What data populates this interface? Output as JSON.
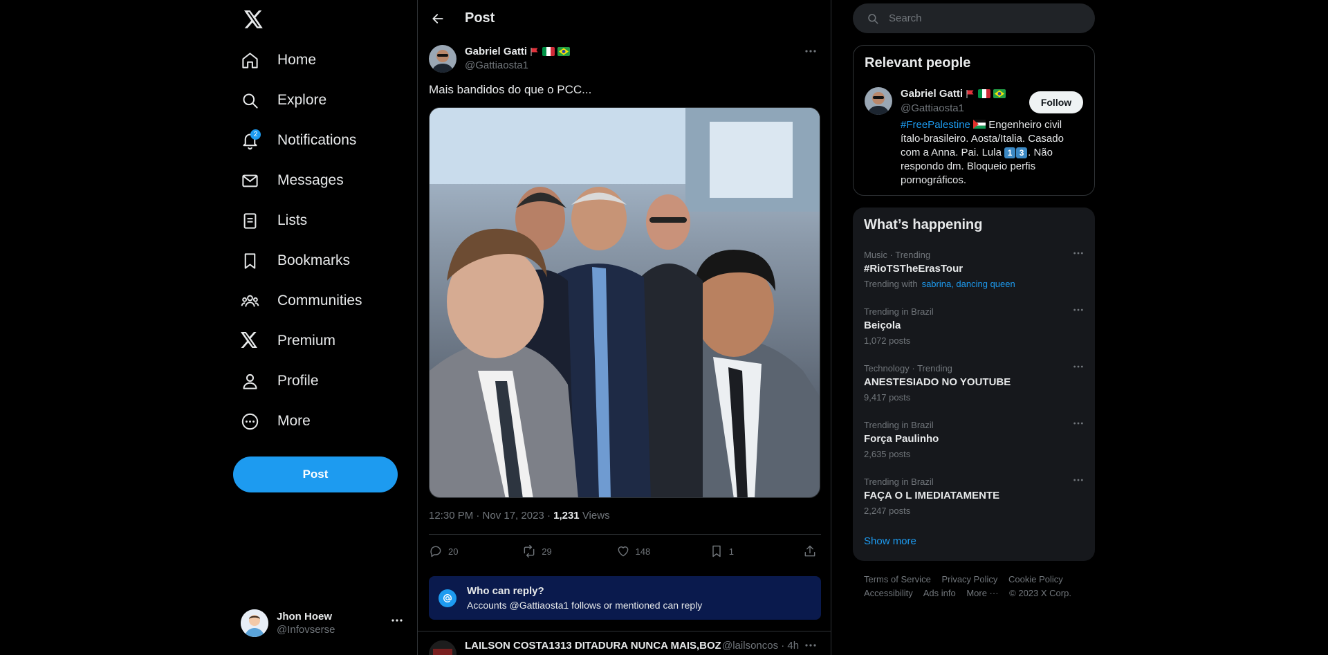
{
  "nav": {
    "logo": "x-logo",
    "items": [
      {
        "label": "Home",
        "icon": "home-icon"
      },
      {
        "label": "Explore",
        "icon": "search-icon"
      },
      {
        "label": "Notifications",
        "icon": "bell-icon",
        "badge": "2"
      },
      {
        "label": "Messages",
        "icon": "envelope-icon"
      },
      {
        "label": "Lists",
        "icon": "list-icon"
      },
      {
        "label": "Bookmarks",
        "icon": "bookmark-icon"
      },
      {
        "label": "Communities",
        "icon": "people-icon"
      },
      {
        "label": "Premium",
        "icon": "x-icon"
      },
      {
        "label": "Profile",
        "icon": "person-icon"
      },
      {
        "label": "More",
        "icon": "more-circle-icon"
      }
    ],
    "post_button": "Post",
    "account": {
      "name": "Jhon Hoew",
      "handle": "@Infovserse"
    }
  },
  "header": {
    "title": "Post"
  },
  "post": {
    "author_name": "Gabriel Gatti",
    "author_handle": "@Gattiaosta1",
    "text": "Mais bandidos do que o PCC...",
    "time": "12:30 PM · Nov 17, 2023",
    "views_count": "1,231",
    "views_label": "Views",
    "replies": "20",
    "reposts": "29",
    "likes": "148",
    "bookmarks": "1"
  },
  "reply_restriction": {
    "title": "Who can reply?",
    "text": "Accounts @Gattiaosta1 follows or mentioned can reply"
  },
  "next_post": {
    "name": "LAILSON COSTA1313 DITADURA NUNCA MAIS,BOZO",
    "handle": "@lailsoncos · 4h"
  },
  "search": {
    "placeholder": "Search"
  },
  "relevant_people": {
    "title": "Relevant people",
    "name": "Gabriel Gatti",
    "handle": "@Gattiaosta1",
    "follow_label": "Follow",
    "bio_tag": "#FreePalestine",
    "bio_line1": "Engenheiro civil ítalo-brasileiro. Aosta/Italia. Casado com a Anna. Pai. Lula",
    "bio_digit1": "1",
    "bio_digit2": "3",
    "bio_line2": ". Não respondo dm. Bloqueio perfis pornográficos."
  },
  "happening": {
    "title": "What’s happening",
    "trends": [
      {
        "context": "Music · Trending",
        "name": "#RioTSTheErasTour",
        "sub_prefix": "Trending with",
        "sub_links": "sabrina, dancing queen"
      },
      {
        "context": "Trending in Brazil",
        "name": "Beiçola",
        "sub_prefix": "1,072 posts",
        "sub_links": ""
      },
      {
        "context": "Technology · Trending",
        "name": "ANESTESIADO NO YOUTUBE",
        "sub_prefix": "9,417 posts",
        "sub_links": ""
      },
      {
        "context": "Trending in Brazil",
        "name": "Força Paulinho",
        "sub_prefix": "2,635 posts",
        "sub_links": ""
      },
      {
        "context": "Trending in Brazil",
        "name": "FAÇA O L IMEDIATAMENTE",
        "sub_prefix": "2,247 posts",
        "sub_links": ""
      }
    ],
    "show_more": "Show more"
  },
  "footer": {
    "links": [
      "Terms of Service",
      "Privacy Policy",
      "Cookie Policy",
      "Accessibility",
      "Ads info",
      "More ···",
      "© 2023 X Corp."
    ]
  },
  "colors": {
    "accent": "#1d9bf0",
    "background": "#000000",
    "text": "#e7e9ea",
    "muted": "#71767b",
    "border": "#2f3336"
  }
}
